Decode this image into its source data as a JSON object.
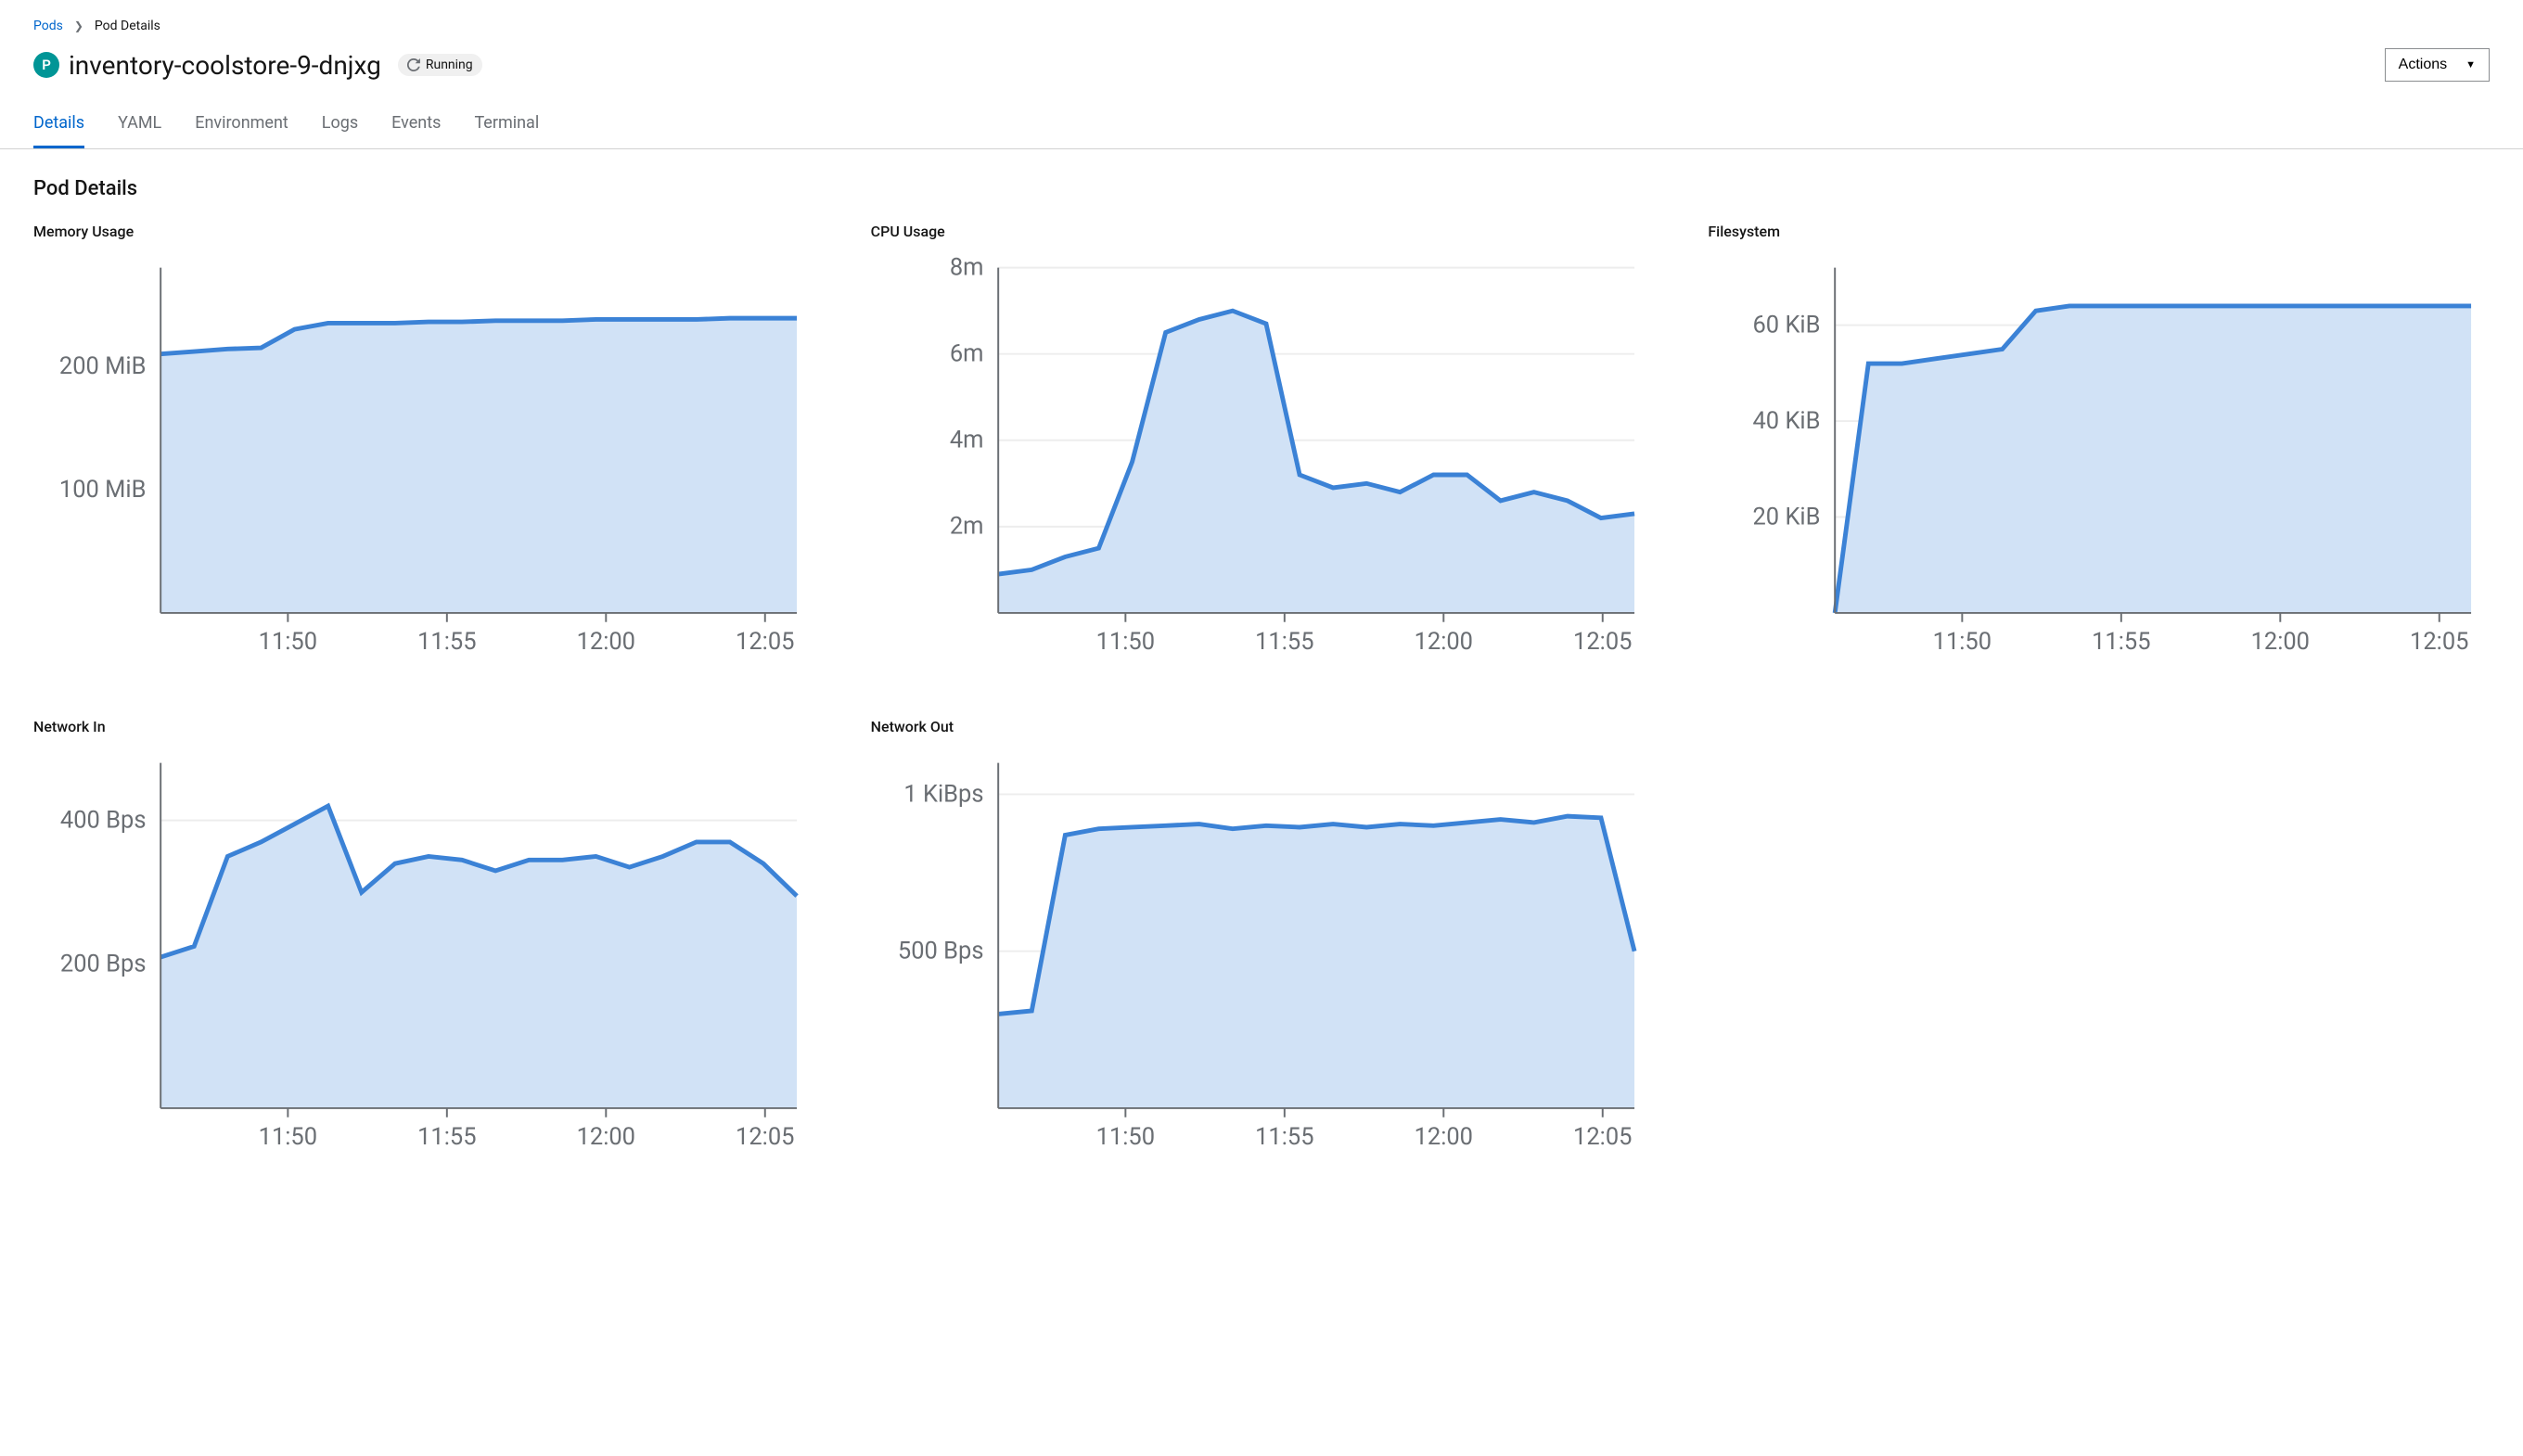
{
  "breadcrumb": {
    "parent": "Pods",
    "current": "Pod Details"
  },
  "pod": {
    "icon_letter": "P",
    "name": "inventory-coolstore-9-dnjxg",
    "status": "Running"
  },
  "actions_label": "Actions",
  "tabs": [
    {
      "label": "Details",
      "active": true
    },
    {
      "label": "YAML",
      "active": false
    },
    {
      "label": "Environment",
      "active": false
    },
    {
      "label": "Logs",
      "active": false
    },
    {
      "label": "Events",
      "active": false
    },
    {
      "label": "Terminal",
      "active": false
    }
  ],
  "section_title": "Pod Details",
  "chart_data": [
    {
      "title": "Memory Usage",
      "type": "area",
      "x_ticks": [
        "11:50",
        "11:55",
        "12:00",
        "12:05"
      ],
      "y_ticks": [
        {
          "v": 100,
          "label": "100 MiB"
        },
        {
          "v": 200,
          "label": "200 MiB"
        }
      ],
      "ylim": [
        0,
        280
      ],
      "x": [
        0,
        1,
        2,
        3,
        4,
        5,
        6,
        7,
        8,
        9,
        10,
        11,
        12,
        13,
        14,
        15,
        16,
        17,
        18,
        19
      ],
      "values": [
        210,
        212,
        214,
        215,
        230,
        235,
        235,
        235,
        236,
        236,
        237,
        237,
        237,
        238,
        238,
        238,
        238,
        239,
        239,
        239
      ]
    },
    {
      "title": "CPU Usage",
      "type": "area",
      "x_ticks": [
        "11:50",
        "11:55",
        "12:00",
        "12:05"
      ],
      "y_ticks": [
        {
          "v": 2,
          "label": "2m"
        },
        {
          "v": 4,
          "label": "4m"
        },
        {
          "v": 6,
          "label": "6m"
        },
        {
          "v": 8,
          "label": "8m"
        }
      ],
      "ylim": [
        0,
        8
      ],
      "x": [
        0,
        1,
        2,
        3,
        4,
        5,
        6,
        7,
        8,
        9,
        10,
        11,
        12,
        13,
        14,
        15,
        16,
        17,
        18,
        19
      ],
      "values": [
        0.9,
        1.0,
        1.3,
        1.5,
        3.5,
        6.5,
        6.8,
        7.0,
        6.7,
        3.2,
        2.9,
        3.0,
        2.8,
        3.2,
        3.2,
        2.6,
        2.8,
        2.6,
        2.2,
        2.3
      ]
    },
    {
      "title": "Filesystem",
      "type": "area",
      "x_ticks": [
        "11:50",
        "11:55",
        "12:00",
        "12:05"
      ],
      "y_ticks": [
        {
          "v": 20,
          "label": "20 KiB"
        },
        {
          "v": 40,
          "label": "40 KiB"
        },
        {
          "v": 60,
          "label": "60 KiB"
        }
      ],
      "ylim": [
        0,
        72
      ],
      "x": [
        0,
        1,
        2,
        3,
        4,
        5,
        6,
        7,
        8,
        9,
        10,
        11,
        12,
        13,
        14,
        15,
        16,
        17,
        18,
        19
      ],
      "values": [
        0,
        52,
        52,
        53,
        54,
        55,
        63,
        64,
        64,
        64,
        64,
        64,
        64,
        64,
        64,
        64,
        64,
        64,
        64,
        64
      ]
    },
    {
      "title": "Network In",
      "type": "area",
      "x_ticks": [
        "11:50",
        "11:55",
        "12:00",
        "12:05"
      ],
      "y_ticks": [
        {
          "v": 200,
          "label": "200 Bps"
        },
        {
          "v": 400,
          "label": "400 Bps"
        }
      ],
      "ylim": [
        0,
        480
      ],
      "x": [
        0,
        1,
        2,
        3,
        4,
        5,
        6,
        7,
        8,
        9,
        10,
        11,
        12,
        13,
        14,
        15,
        16,
        17,
        18,
        19
      ],
      "values": [
        210,
        225,
        350,
        370,
        395,
        420,
        300,
        340,
        350,
        345,
        330,
        345,
        345,
        350,
        335,
        350,
        370,
        370,
        340,
        295
      ]
    },
    {
      "title": "Network Out",
      "type": "area",
      "x_ticks": [
        "11:50",
        "11:55",
        "12:00",
        "12:05"
      ],
      "y_ticks": [
        {
          "v": 500,
          "label": "500 Bps"
        },
        {
          "v": 1000,
          "label": "1 KiBps"
        }
      ],
      "ylim": [
        0,
        1100
      ],
      "x": [
        0,
        1,
        2,
        3,
        4,
        5,
        6,
        7,
        8,
        9,
        10,
        11,
        12,
        13,
        14,
        15,
        16,
        17,
        18,
        19
      ],
      "values": [
        300,
        310,
        870,
        890,
        895,
        900,
        905,
        890,
        900,
        895,
        905,
        895,
        905,
        900,
        910,
        920,
        910,
        930,
        925,
        500
      ]
    }
  ]
}
